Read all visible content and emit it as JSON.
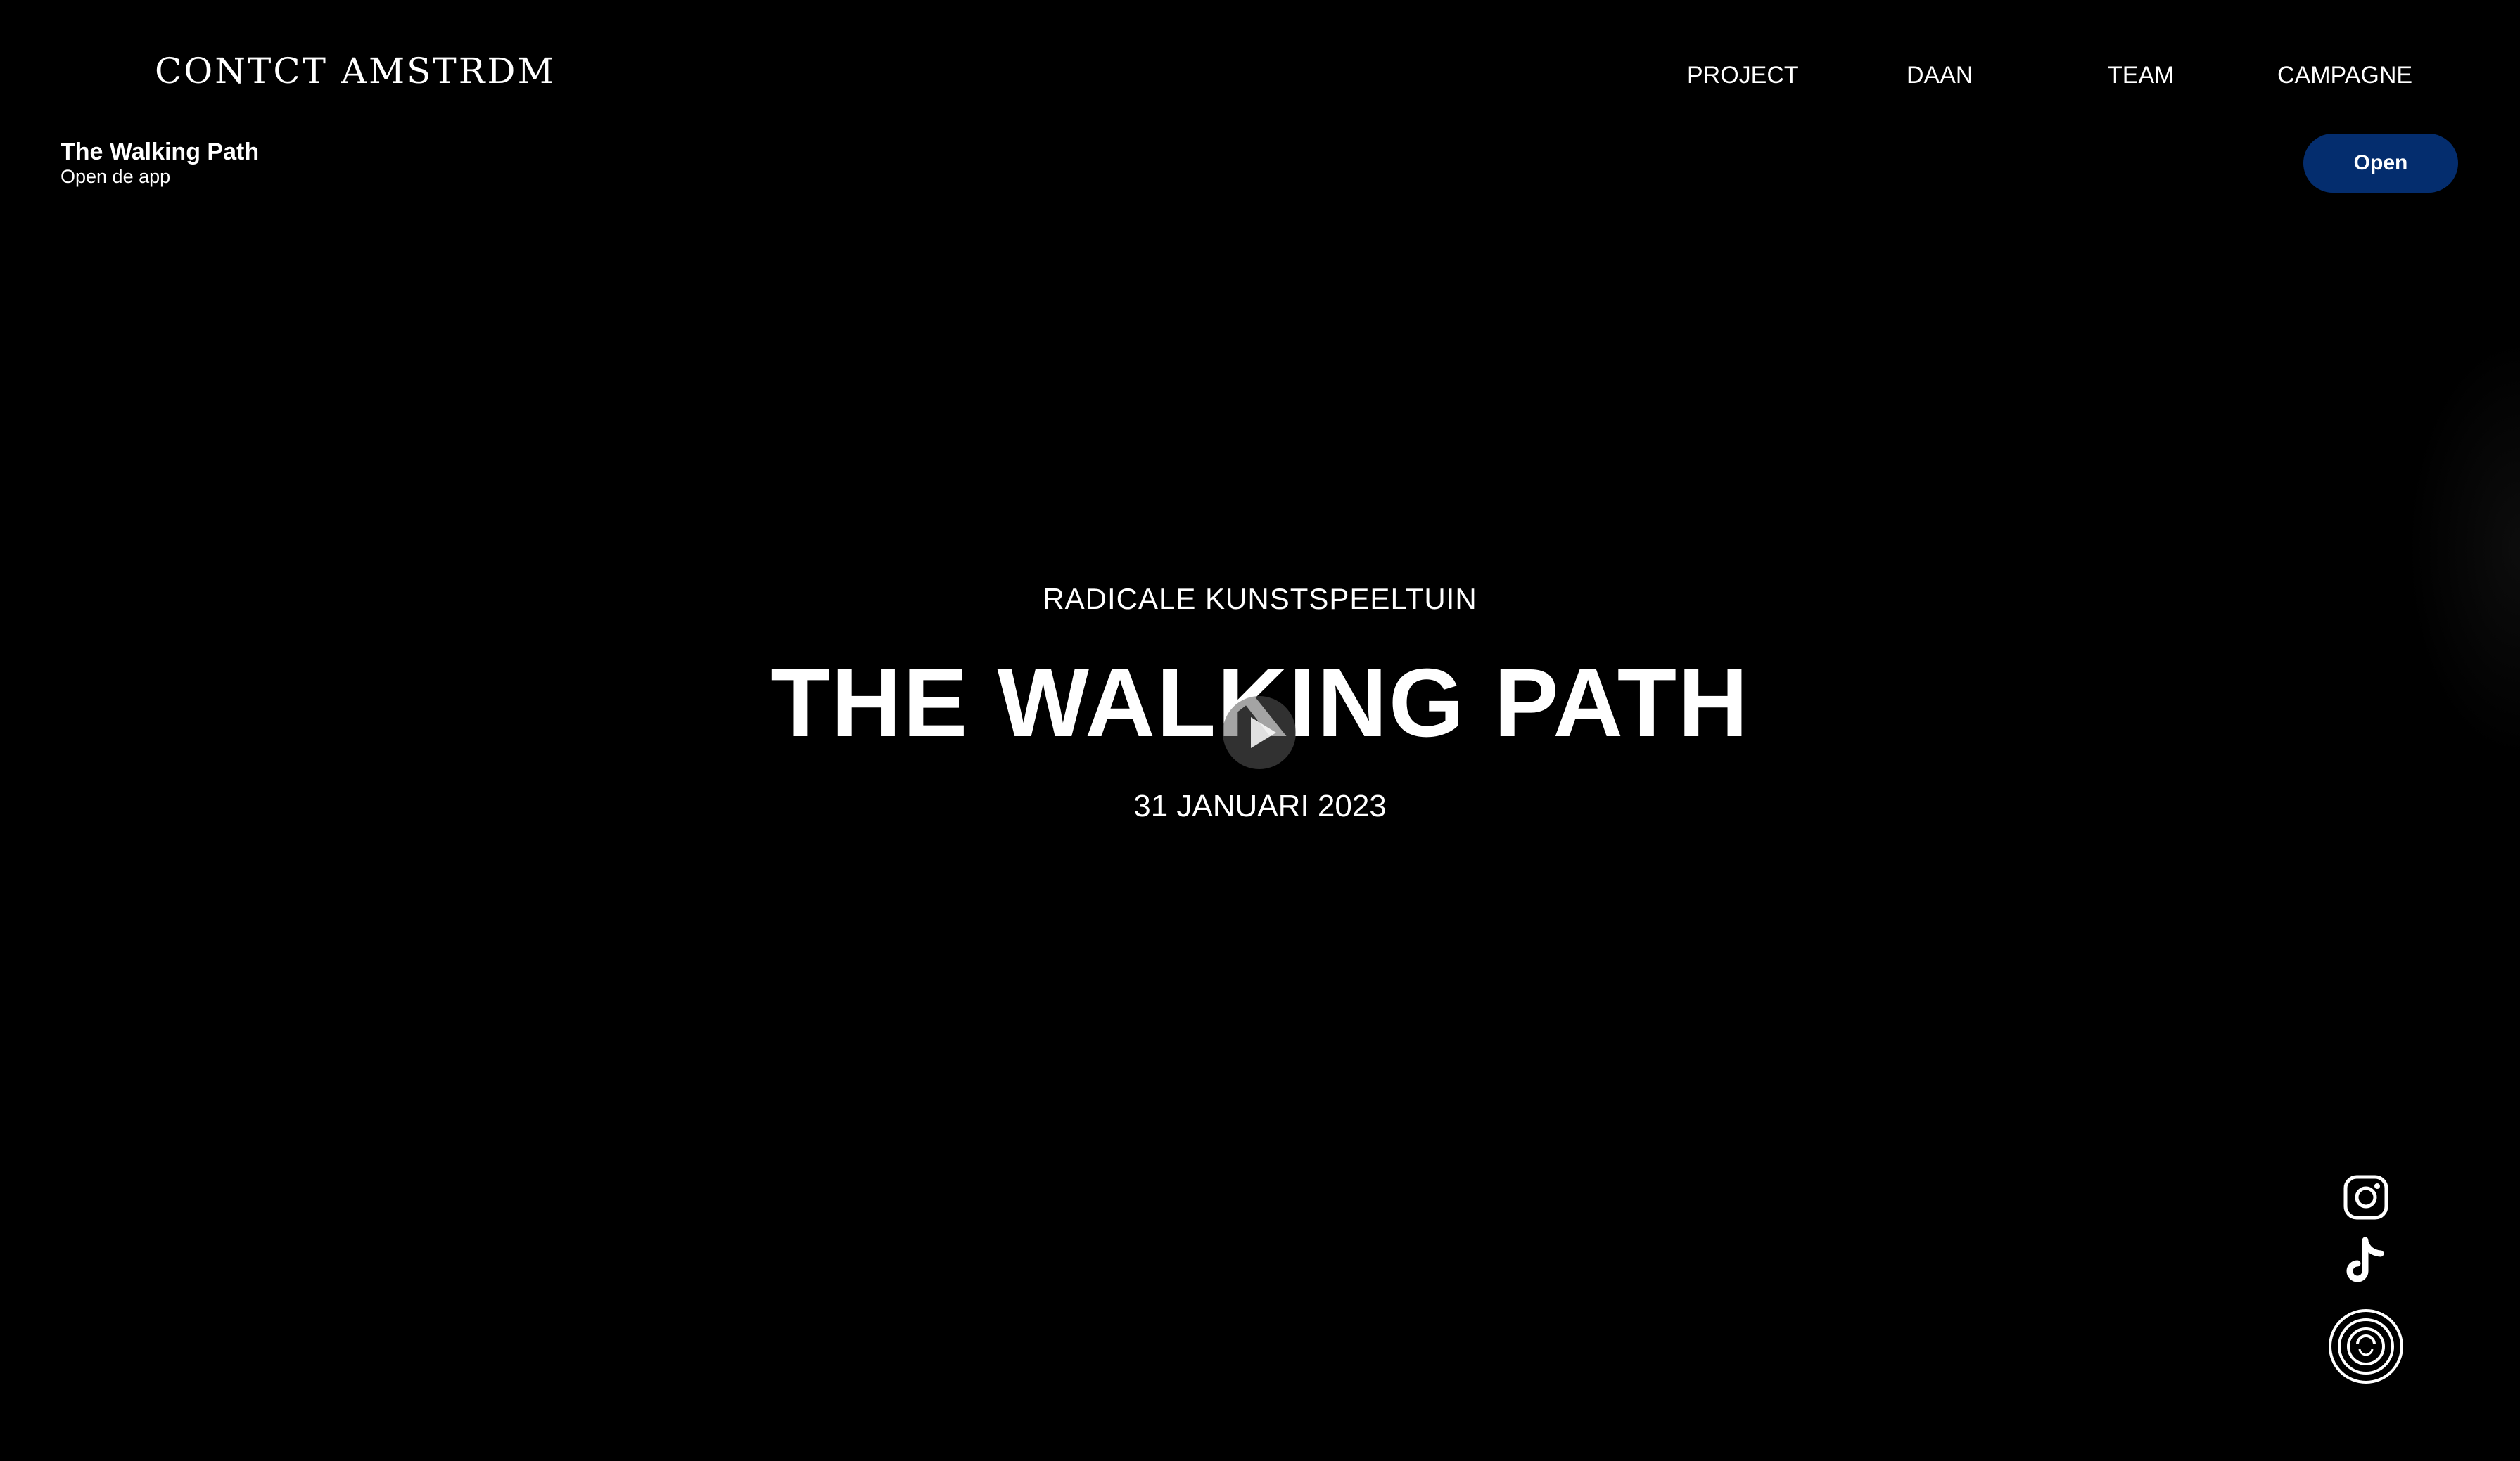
{
  "header": {
    "logo_text": "CONTCT AMSTRDM",
    "nav": [
      {
        "label": "PROJECT"
      },
      {
        "label": "DAAN"
      },
      {
        "label": "TEAM"
      },
      {
        "label": "CAMPAGNE"
      }
    ]
  },
  "app_banner": {
    "title": "The Walking Path",
    "subtitle": "Open de app",
    "button_label": "Open",
    "button_color": "#042d6e"
  },
  "hero": {
    "subtitle": "RADICALE KUNSTSPEELTUIN",
    "title": "THE WALKING PATH",
    "date": "31 JANUARI 2023",
    "play_icon": "play-icon"
  },
  "social": [
    {
      "icon": "instagram-icon"
    },
    {
      "icon": "tiktok-icon"
    },
    {
      "icon": "circle-logo-icon"
    }
  ],
  "colors": {
    "background": "#000000",
    "text": "#ffffff"
  }
}
